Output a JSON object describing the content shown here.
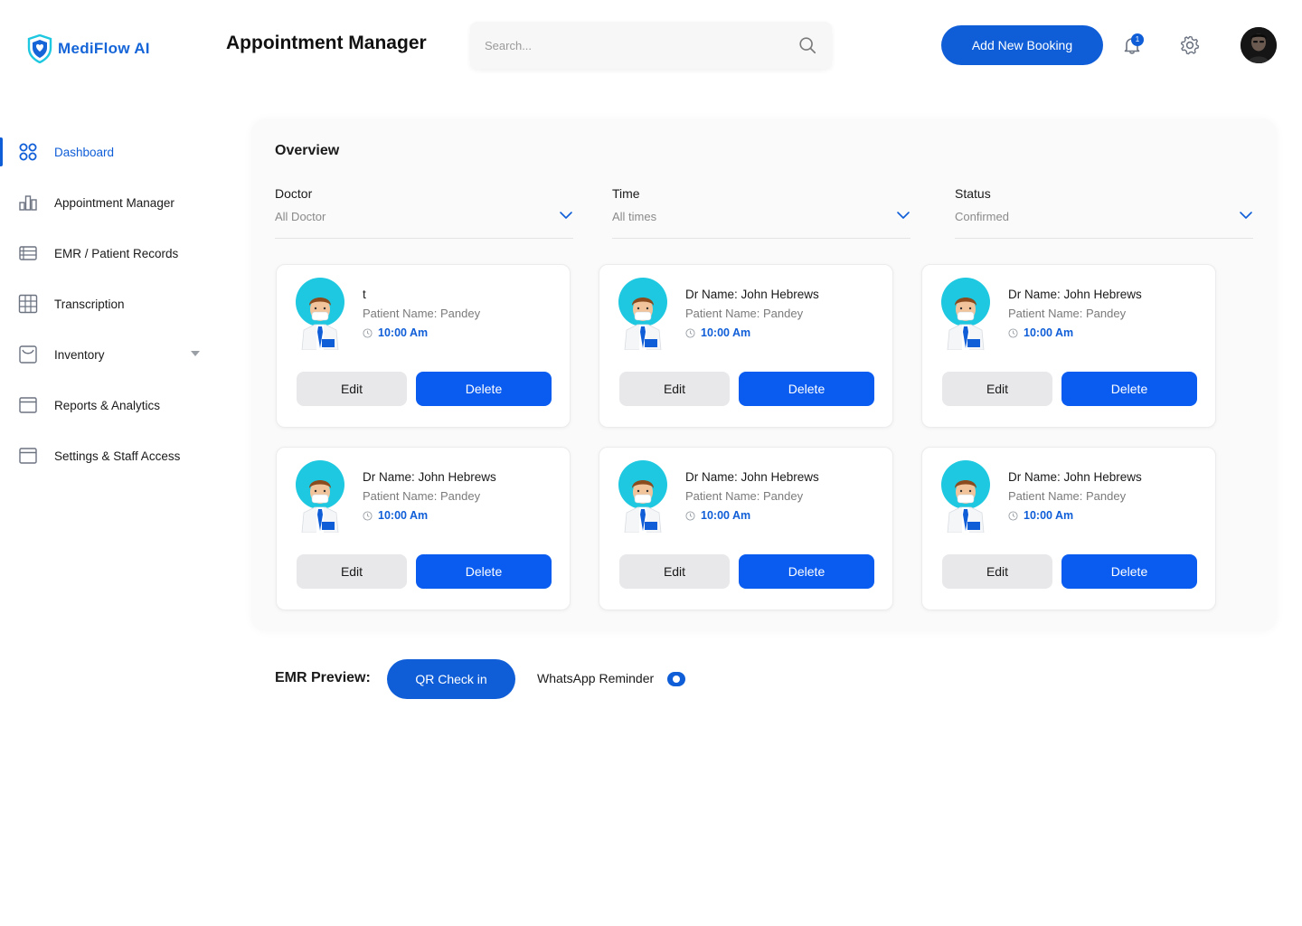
{
  "app": {
    "logo_text": "MediFlow  AI"
  },
  "header": {
    "title": "Appointment Manager",
    "search_placeholder": "Search...",
    "add_booking_label": "Add New Booking",
    "notification_count": "1"
  },
  "sidebar": {
    "items": [
      {
        "label": "Dashboard",
        "icon": "grid-icon",
        "active": true
      },
      {
        "label": "Appointment Manager",
        "icon": "bar-chart-icon"
      },
      {
        "label": "EMR / Patient Records",
        "icon": "list-icon"
      },
      {
        "label": "Transcription",
        "icon": "table-icon"
      },
      {
        "label": "Inventory",
        "icon": "inbox-icon",
        "has_dropdown": true
      },
      {
        "label": "Reports & Analytics",
        "icon": "window-icon"
      },
      {
        "label": "Settings & Staff Access",
        "icon": "window-icon"
      }
    ]
  },
  "overview": {
    "title": "Overview",
    "filters": [
      {
        "label": "Doctor",
        "value": "All Doctor"
      },
      {
        "label": "Time",
        "value": "All times"
      },
      {
        "label": "Status",
        "value": "Confirmed"
      }
    ],
    "cards": [
      {
        "doctor": "t",
        "patient": "Patient Name: Pandey",
        "time": "10:00 Am",
        "edit": "Edit",
        "delete": "Delete"
      },
      {
        "doctor": "Dr Name: John Hebrews",
        "patient": "Patient Name: Pandey",
        "time": "10:00 Am",
        "edit": "Edit",
        "delete": "Delete"
      },
      {
        "doctor": "Dr Name: John Hebrews",
        "patient": "Patient Name: Pandey",
        "time": "10:00 Am",
        "edit": "Edit",
        "delete": "Delete"
      },
      {
        "doctor": "Dr Name: John Hebrews",
        "patient": "Patient Name: Pandey",
        "time": "10:00 Am",
        "edit": "Edit",
        "delete": "Delete"
      },
      {
        "doctor": "Dr Name: John Hebrews",
        "patient": "Patient Name: Pandey",
        "time": "10:00 Am",
        "edit": "Edit",
        "delete": "Delete"
      },
      {
        "doctor": "Dr Name: John Hebrews",
        "patient": "Patient Name: Pandey",
        "time": "10:00 Am",
        "edit": "Edit",
        "delete": "Delete"
      }
    ]
  },
  "emr_bar": {
    "label": "EMR Preview:",
    "qr_label": "QR Check in",
    "whatsapp_label": "WhatsApp Reminder",
    "whatsapp_on": true
  },
  "colors": {
    "primary": "#0f5ed8",
    "delete": "#0a5cf0",
    "doctor_bg": "#1ec8e0"
  }
}
